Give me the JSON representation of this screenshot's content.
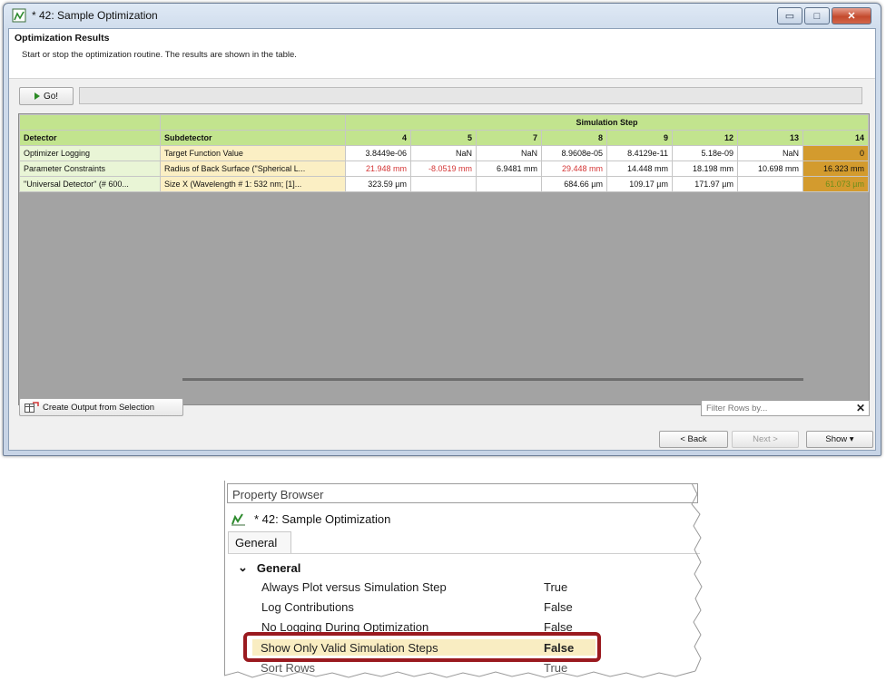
{
  "window": {
    "title": "* 42: Sample Optimization",
    "header_title": "Optimization Results",
    "header_subtitle": "Start or stop the optimization routine. The results are shown in the table.",
    "go_label": "Go!",
    "create_output_label": "Create Output from Selection",
    "filter_placeholder": "Filter Rows by...",
    "filter_clear": "✕",
    "back_label": "< Back",
    "next_label": "Next >",
    "show_label": "Show ▾",
    "min_glyph": "▭",
    "max_glyph": "□",
    "close_glyph": "✕"
  },
  "table": {
    "group_header": "Simulation Step",
    "col_detector": "Detector",
    "col_subdetector": "Subdetector",
    "steps": [
      "4",
      "5",
      "7",
      "8",
      "9",
      "12",
      "13",
      "14"
    ],
    "rows": [
      {
        "detector": "Optimizer Logging",
        "subdetector": "Target Function Value",
        "cells": [
          "3.8449e-06",
          "NaN",
          "NaN",
          "8.9608e-05",
          "8.4129e-11",
          "5.18e-09",
          "NaN",
          "0"
        ]
      },
      {
        "detector": "Parameter Constraints",
        "subdetector": "Radius of Back Surface (\"Spherical L...",
        "cells": [
          "21.948 mm",
          "-8.0519 mm",
          "6.9481 mm",
          "29.448 mm",
          "14.448 mm",
          "18.198 mm",
          "10.698 mm",
          "16.323 mm"
        ]
      },
      {
        "detector": "\"Universal Detector\" (# 600...",
        "subdetector": "Size X (Wavelength # 1: 532 nm; [1]...",
        "cells": [
          "323.59 µm",
          "",
          "",
          "684.66 µm",
          "109.17 µm",
          "171.97 µm",
          "",
          "61.073 µm"
        ]
      }
    ]
  },
  "property_browser": {
    "title": "Property Browser",
    "object_name": "* 42: Sample Optimization",
    "tab_label": "General",
    "group_label": "General",
    "group_toggle": "⌄",
    "rows": [
      {
        "label": "Always Plot versus Simulation Step",
        "value": "True"
      },
      {
        "label": "Log Contributions",
        "value": "False"
      },
      {
        "label": "No Logging During Optimization",
        "value": "False"
      },
      {
        "label": "Show Only Valid Simulation Steps",
        "value": "False"
      },
      {
        "label": "Sort Rows",
        "value": "True"
      }
    ]
  },
  "colors": {
    "header_green": "#c2e48e",
    "subdetector_yellow": "#fbefc4",
    "highlight_orange": "#d39b2e",
    "invalid_red": "#d43535",
    "callout_red": "#9a1a1f"
  }
}
